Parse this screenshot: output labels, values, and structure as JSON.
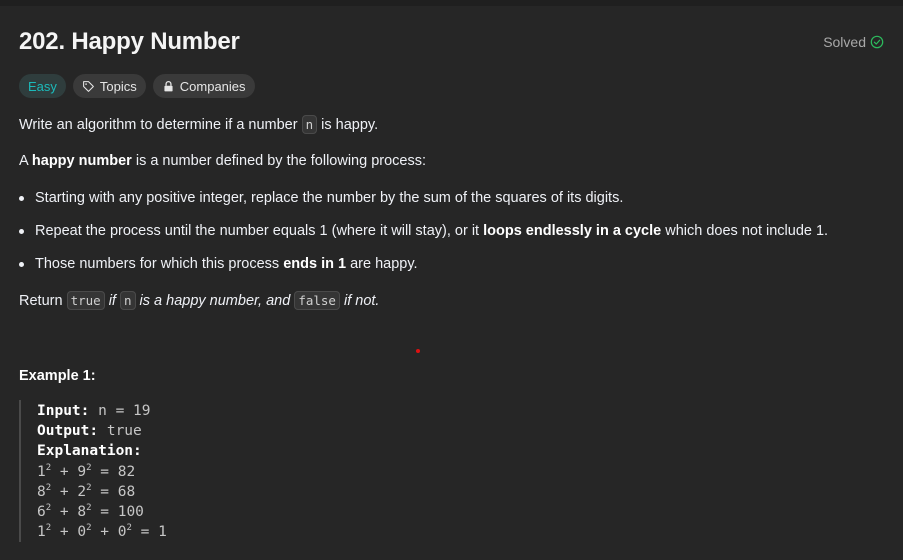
{
  "problem": {
    "title": "202. Happy Number",
    "status": "Solved",
    "difficulty": "Easy",
    "topics_label": "Topics",
    "companies_label": "Companies"
  },
  "description": {
    "p1_a": "Write an algorithm to determine if a number ",
    "p1_code": "n",
    "p1_b": " is happy.",
    "p2_a": "A ",
    "p2_bold": "happy number",
    "p2_b": " is a number defined by the following process:",
    "bullets": [
      {
        "text_a": "Starting with any positive integer, replace the number by the sum of the squares of its digits.",
        "bold": "",
        "text_b": ""
      },
      {
        "text_a": "Repeat the process until the number equals 1 (where it will stay), or it ",
        "bold": "loops endlessly in a cycle",
        "text_b": " which does not include 1."
      },
      {
        "text_a": "Those numbers for which this process ",
        "bold": "ends in 1",
        "text_b": " are happy."
      }
    ],
    "ret_a": "Return ",
    "ret_code1": "true",
    "ret_b": " if ",
    "ret_code2": "n",
    "ret_c": " is a happy number, and ",
    "ret_code3": "false",
    "ret_d": " if not."
  },
  "example": {
    "title": "Example 1:",
    "input_label": "Input:",
    "input_value": " n = 19",
    "output_label": "Output:",
    "output_value": " true",
    "explanation_label": "Explanation:",
    "lines": [
      {
        "a": "1",
        "b": "9",
        "c": "",
        "result": "82"
      },
      {
        "a": "8",
        "b": "2",
        "c": "",
        "result": "68"
      },
      {
        "a": "6",
        "b": "8",
        "c": "",
        "result": "100"
      },
      {
        "a": "1",
        "b": "0",
        "c": "0",
        "result": "1"
      }
    ],
    "exponent": "2"
  },
  "colors": {
    "background": "#262626",
    "easy": "#1cbaba",
    "solved_check": "#2cbb5d"
  }
}
